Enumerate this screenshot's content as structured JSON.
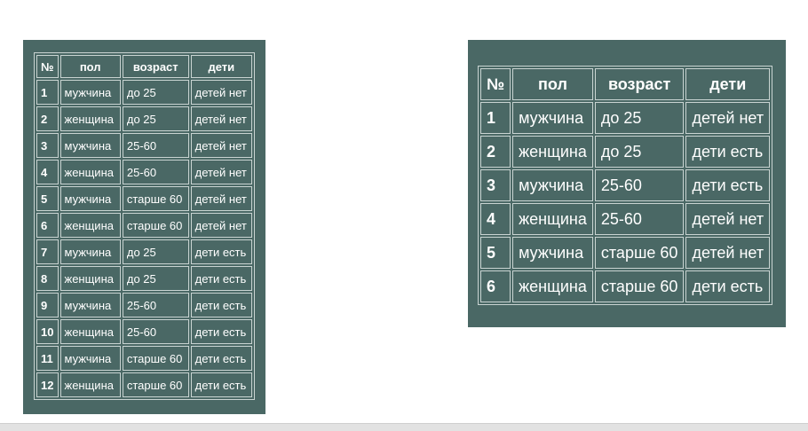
{
  "tables": {
    "left": {
      "headers": [
        "№",
        "пол",
        "возраст",
        "дети"
      ],
      "rows": [
        [
          "1",
          "мужчина",
          "до 25",
          "детей нет"
        ],
        [
          "2",
          "женщина",
          "до 25",
          "детей нет"
        ],
        [
          "3",
          "мужчина",
          "25-60",
          "детей нет"
        ],
        [
          "4",
          "женщина",
          "25-60",
          "детей нет"
        ],
        [
          "5",
          "мужчина",
          "старше 60",
          "детей нет"
        ],
        [
          "6",
          "женщина",
          "старше 60",
          "детей нет"
        ],
        [
          "7",
          "мужчина",
          "до 25",
          "дети есть"
        ],
        [
          "8",
          "женщина",
          "до 25",
          "дети есть"
        ],
        [
          "9",
          "мужчина",
          "25-60",
          "дети есть"
        ],
        [
          "10",
          "женщина",
          "25-60",
          "дети есть"
        ],
        [
          "11",
          "мужчина",
          "старше 60",
          "дети есть"
        ],
        [
          "12",
          "женщина",
          "старше 60",
          "дети есть"
        ]
      ]
    },
    "right": {
      "headers": [
        "№",
        "пол",
        "возраст",
        "дети"
      ],
      "rows": [
        [
          "1",
          "мужчина",
          "до 25",
          "детей нет"
        ],
        [
          "2",
          "женщина",
          "до 25",
          "дети есть"
        ],
        [
          "3",
          "мужчина",
          "25-60",
          "дети есть"
        ],
        [
          "4",
          "женщина",
          "25-60",
          "детей нет"
        ],
        [
          "5",
          "мужчина",
          "старше 60",
          "детей нет"
        ],
        [
          "6",
          "женщина",
          "старше 60",
          "дети есть"
        ]
      ]
    }
  },
  "colors": {
    "panel_bg": "#4a6865",
    "cell_border": "#c9d4d2",
    "text": "#ffffff"
  }
}
